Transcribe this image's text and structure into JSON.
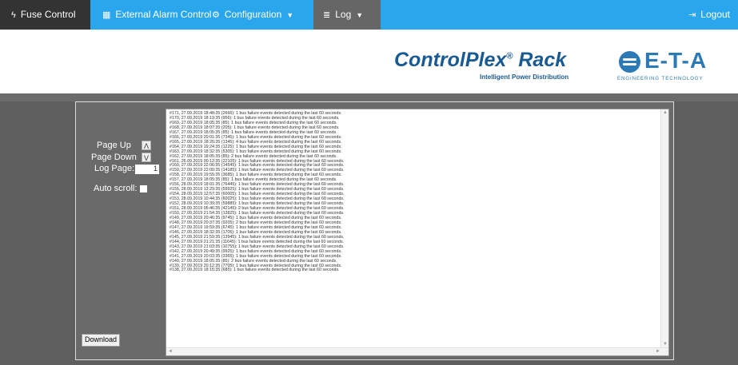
{
  "nav": {
    "fuse": {
      "label": "Fuse Control",
      "icon": "ϟ"
    },
    "alarm": {
      "label": "External Alarm Control",
      "icon": "▦"
    },
    "config": {
      "label": "Configuration",
      "icon": "⚙",
      "caret": "▼"
    },
    "log": {
      "label": "Log",
      "icon": "≣",
      "caret": "▼"
    },
    "logout": {
      "label": "Logout",
      "icon": "⇥"
    }
  },
  "brand": {
    "product": "ControlPlex",
    "registered": "®",
    "rack": "Rack",
    "subtitle": "Intelligent Power Distribution",
    "company": "E-T-A",
    "tagline": "ENGINEERING TECHNOLOGY"
  },
  "controls": {
    "page_up": "Page Up",
    "page_up_btn": "Λ",
    "page_down": "Page Down",
    "page_down_btn": "V",
    "log_page": "Log Page:",
    "log_page_value": "1",
    "auto_scroll": "Auto scroll:",
    "download": "Download"
  },
  "log": {
    "lines": [
      "#171, 27.09.2019 18:48:35 (2666): 1 bus failure events detected during the last 60 seconds.",
      "#170, 27.09.2019 18:19:35 (956): 1 bus failure events detected during the last 60 seconds.",
      "#169, 27.09.2019 18:05:35 (85): 1 bus failure events detected during the last 60 seconds.",
      "#168, 27.09.2019 18:07:35 (205): 1 bus failure events detected during the last 60 seconds.",
      "#167, 27.09.2019 18:05:35 (85): 1 bus failure events detected during the last 60 seconds.",
      "#166, 27.09.2019 20:01:35 (7345): 1 bus failure events detected during the last 60 seconds.",
      "#165, 27.09.2019 18:26:35 (1345): 4 bus failure events detected during the last 60 seconds.",
      "#164, 27.09.2019 19:24:35 (1225): 1 bus failure events detected during the last 60 seconds.",
      "#163, 27.09.2019 18:32:35 (5305): 1 bus failure events detected during the last 60 seconds.",
      "#162, 27.09.2019 18:05:35 (85): 2 bus failure events detected during the last 60 seconds.",
      "#161, 26.09.2019 00:12:35 (22105): 1 bus failure events detected during the last 60 seconds.",
      "#160, 27.09.2019 22:06:35 (14545): 1 bus failure events detected during the last 60 seconds.",
      "#159, 27.09.2019 22:00:35 (14185): 1 bus failure events detected during the last 60 seconds.",
      "#158, 27.09.2019 19:55:35 (3685): 1 bus failure events detected during the last 60 seconds.",
      "#157, 27.09.2019 18:05:35 (85): 1 bus failure events detected during the last 60 seconds.",
      "#156, 28.09.2019 18:01:35 (76445): 1 bus failure events detected during the last 60 seconds.",
      "#155, 28.09.2019 13:29:35 (59925): 1 bus failure events detected during the last 60 seconds.",
      "#154, 28.09.2019 12:57:35 (60005): 1 bus failure events detected during the last 60 seconds.",
      "#153, 28.09.2019 10:44:35 (60025): 1 bus failure events detected during the last 60 seconds.",
      "#152, 28.09.2019 10:39:35 (59885): 1 bus failure events detected during the last 60 seconds.",
      "#151, 28.09.2019 05:46:35 (42145): 2 bus failure events detected during the last 60 seconds.",
      "#150, 27.09.2019 21:54:35 (13825): 1 bus failure events detected during the last 60 seconds.",
      "#149, 27.09.2019 20:46:35 (9745): 1 bus failure events detected during the last 60 seconds.",
      "#148, 27.09.2019 20:37:35 (9205): 2 bus failure events detected during the last 60 seconds.",
      "#147, 27.09.2019 19:59:35 (6745): 1 bus failure events detected during the last 60 seconds.",
      "#146, 27.09.2019 18:32:35 (1705): 1 bus failure events detected during the last 60 seconds.",
      "#145, 27.09.2019 21:59:35 (13945): 1 bus failure events detected during the last 60 seconds.",
      "#144, 27.09.2019 21:21:35 (11645): 1 bus failure events detected during the last 60 seconds.",
      "#143, 27.09.2019 21:03:35 (10755): 1 bus failure events detected during the last 60 seconds.",
      "#142, 27.09.2019 20:49:35 (9925): 1 bus failure events detected during the last 60 seconds.",
      "#141, 27.09.2019 20:03:35 (3365): 1 bus failure events detected during the last 60 seconds.",
      "#140, 27.09.2019 18:05:35 (85): 2 bus failure events detected during the last 60 seconds.",
      "#139, 27.09.2019 20:12:35 (7705): 1 bus failure events detected during the last 60 seconds.",
      "#138, 27.09.2019 18:15:35 (685): 1 bus failure events detected during the last 60 seconds."
    ]
  },
  "scroll": {
    "up": "▲",
    "down": "▼",
    "left": "◄",
    "right": "►"
  }
}
